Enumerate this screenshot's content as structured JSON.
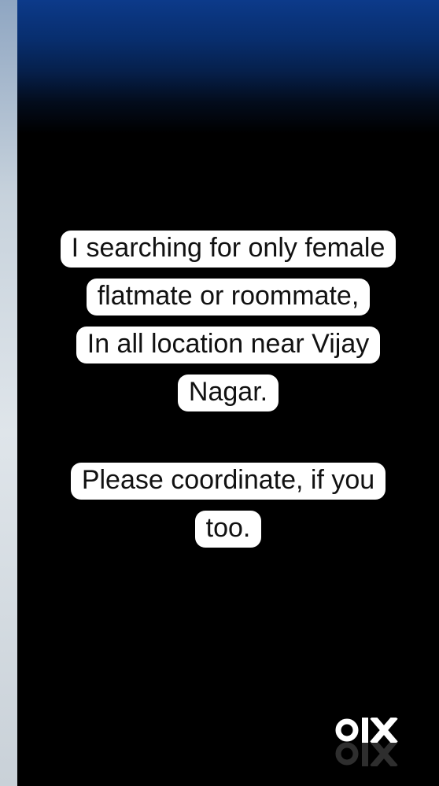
{
  "story": {
    "caption_1_lines": [
      "I searching for only female",
      "flatmate or roommate,",
      "In all location near Vijay",
      "Nagar."
    ],
    "caption_2_lines": [
      "Please coordinate, if you",
      "too."
    ],
    "background_colors": {
      "top": "#0c3a8a",
      "bottom": "#000000",
      "caption_bg": "#ffffff",
      "caption_text": "#111111"
    }
  },
  "watermark": {
    "brand": "OLX",
    "icon": "olx-logo-icon",
    "color": "#ffffff"
  }
}
